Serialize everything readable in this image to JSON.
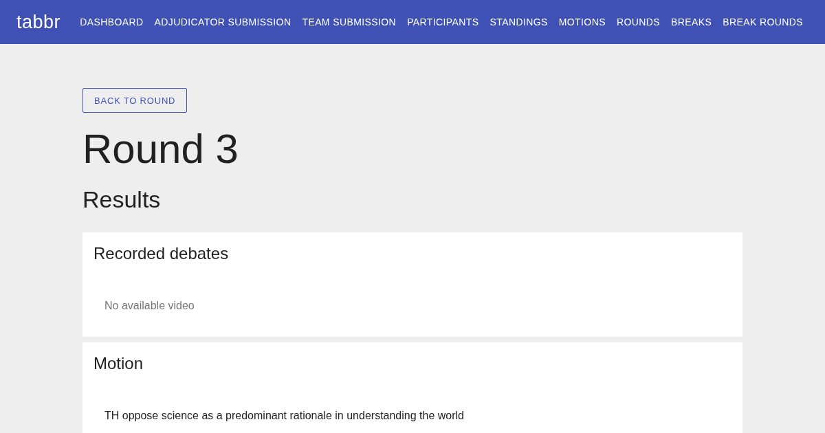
{
  "header": {
    "logo": "tabbr",
    "nav": [
      {
        "label": "DASHBOARD"
      },
      {
        "label": "ADJUDICATOR SUBMISSION"
      },
      {
        "label": "TEAM SUBMISSION"
      },
      {
        "label": "PARTICIPANTS"
      },
      {
        "label": "STANDINGS"
      },
      {
        "label": "MOTIONS"
      },
      {
        "label": "ROUNDS"
      },
      {
        "label": "BREAKS"
      },
      {
        "label": "BREAK ROUNDS"
      }
    ]
  },
  "back_button": "BACK TO ROUND",
  "title": "Round 3",
  "subtitle": "Results",
  "cards": [
    {
      "title": "Recorded debates",
      "body": "No available video",
      "kind": "muted"
    },
    {
      "title": "Motion",
      "body": "TH oppose science as a predominant rationale in understanding the world",
      "kind": "plain"
    }
  ]
}
